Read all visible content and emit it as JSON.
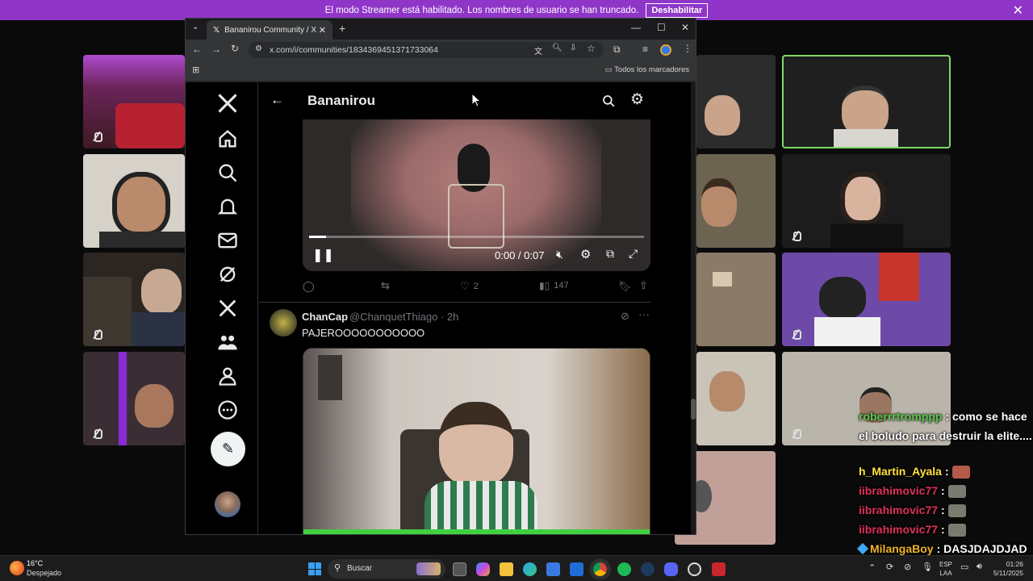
{
  "streamer_banner": {
    "message": "El modo Streamer está habilitado. Los nombres de usuario se han truncado.",
    "disable_button": "Deshabilitar"
  },
  "browser": {
    "tab_title": "Bananirou Community / X",
    "url": "x.com/i/communities/1834369451371733064",
    "bookmarks_label": "Todos los marcadores"
  },
  "x": {
    "header_title": "Bananirou",
    "video1": {
      "time": "0:00 / 0:07",
      "likes": "2",
      "views": "147",
      "progress_fraction": 0.05
    },
    "tweet2": {
      "display_name": "ChanCap",
      "handle_time": "@ChanquetThiago · 2h",
      "text": "PAJEROOOOOOOOOOO"
    }
  },
  "chat": [
    {
      "user": "roberrrtromppp",
      "text": "como se hace el boludo para destruir la elite....",
      "color": "#62c850"
    },
    {
      "user": "h_Martin_Ayala",
      "text": "",
      "emote": true,
      "color": "#ffe13b"
    },
    {
      "user": "iibrahimovic77",
      "text": "",
      "emote": true,
      "color": "#e0315a"
    },
    {
      "user": "iibrahimovic77",
      "text": "",
      "emote": true,
      "color": "#e0315a"
    },
    {
      "user": "iibrahimovic77",
      "text": "",
      "emote": true,
      "color": "#e0315a"
    },
    {
      "user": "MilangaBoy",
      "text": "DASJDAJDJAD",
      "color": "#f0b428"
    }
  ],
  "taskbar": {
    "weather_temp": "16°C",
    "weather_desc": "Despejado",
    "search_placeholder": "Buscar",
    "lang_top": "ESP",
    "lang_bottom": "LAA",
    "time": "01:26",
    "date": "5/11/2025"
  },
  "colors": {
    "banner": "#8f36c9",
    "x_bg": "#000000",
    "video_progress": "#3fd13f"
  }
}
